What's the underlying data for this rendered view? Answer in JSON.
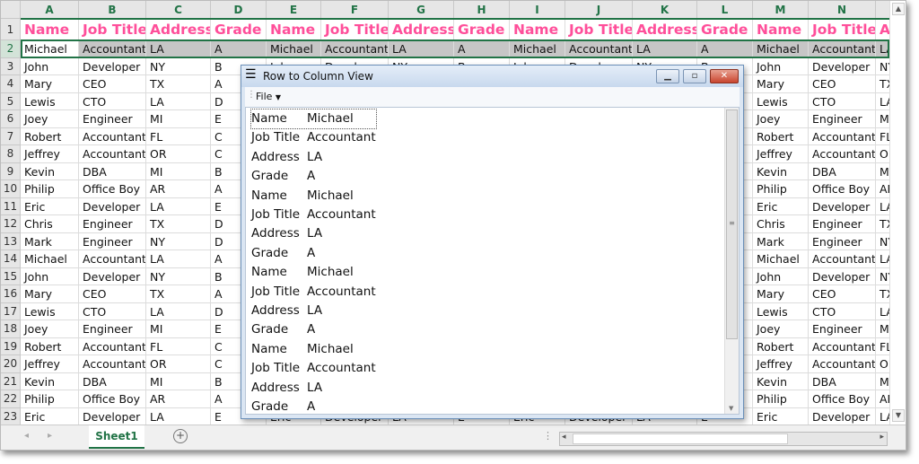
{
  "spreadsheet": {
    "columns": [
      "A",
      "B",
      "C",
      "D",
      "E",
      "F",
      "G",
      "H",
      "I",
      "J",
      "K",
      "L",
      "M",
      "N",
      "O"
    ],
    "headers": [
      "Name",
      "Job Title",
      "Address",
      "Grade"
    ],
    "rows": [
      [
        "Michael",
        "Accountant",
        "LA",
        "A"
      ],
      [
        "John",
        "Developer",
        "NY",
        "B"
      ],
      [
        "Mary",
        "CEO",
        "TX",
        "A"
      ],
      [
        "Lewis",
        "CTO",
        "LA",
        "D"
      ],
      [
        "Joey",
        "Engineer",
        "MI",
        "E"
      ],
      [
        "Robert",
        "Accountant",
        "FL",
        "C"
      ],
      [
        "Jeffrey",
        "Accountant",
        "OR",
        "C"
      ],
      [
        "Kevin",
        "DBA",
        "MI",
        "B"
      ],
      [
        "Philip",
        "Office Boy",
        "AR",
        "A"
      ],
      [
        "Eric",
        "Developer",
        "LA",
        "E"
      ],
      [
        "Chris",
        "Engineer",
        "TX",
        "D"
      ],
      [
        "Mark",
        "Engineer",
        "NY",
        "D"
      ],
      [
        "Michael",
        "Accountant",
        "LA",
        "A"
      ],
      [
        "John",
        "Developer",
        "NY",
        "B"
      ],
      [
        "Mary",
        "CEO",
        "TX",
        "A"
      ],
      [
        "Lewis",
        "CTO",
        "LA",
        "D"
      ],
      [
        "Joey",
        "Engineer",
        "MI",
        "E"
      ],
      [
        "Robert",
        "Accountant",
        "FL",
        "C"
      ],
      [
        "Jeffrey",
        "Accountant",
        "OR",
        "C"
      ],
      [
        "Kevin",
        "DBA",
        "MI",
        "B"
      ],
      [
        "Philip",
        "Office Boy",
        "AR",
        "A"
      ],
      [
        "Eric",
        "Developer",
        "LA",
        "E"
      ]
    ],
    "selected_row": 2,
    "header_color": "#ff4f9a",
    "accent_color": "#217346"
  },
  "sheet_tabs": {
    "active": "Sheet1",
    "add_icon": "plus-circle-icon"
  },
  "dialog": {
    "title": "Row to Column View",
    "menu_file": "File",
    "items": [
      [
        "Name",
        "Michael"
      ],
      [
        "Job Title",
        "Accountant"
      ],
      [
        "Address",
        "LA"
      ],
      [
        "Grade",
        "A"
      ],
      [
        "Name",
        "Michael"
      ],
      [
        "Job Title",
        "Accountant"
      ],
      [
        "Address",
        "LA"
      ],
      [
        "Grade",
        "A"
      ],
      [
        "Name",
        "Michael"
      ],
      [
        "Job Title",
        "Accountant"
      ],
      [
        "Address",
        "LA"
      ],
      [
        "Grade",
        "A"
      ],
      [
        "Name",
        "Michael"
      ],
      [
        "Job Title",
        "Accountant"
      ],
      [
        "Address",
        "LA"
      ],
      [
        "Grade",
        "A"
      ]
    ]
  }
}
